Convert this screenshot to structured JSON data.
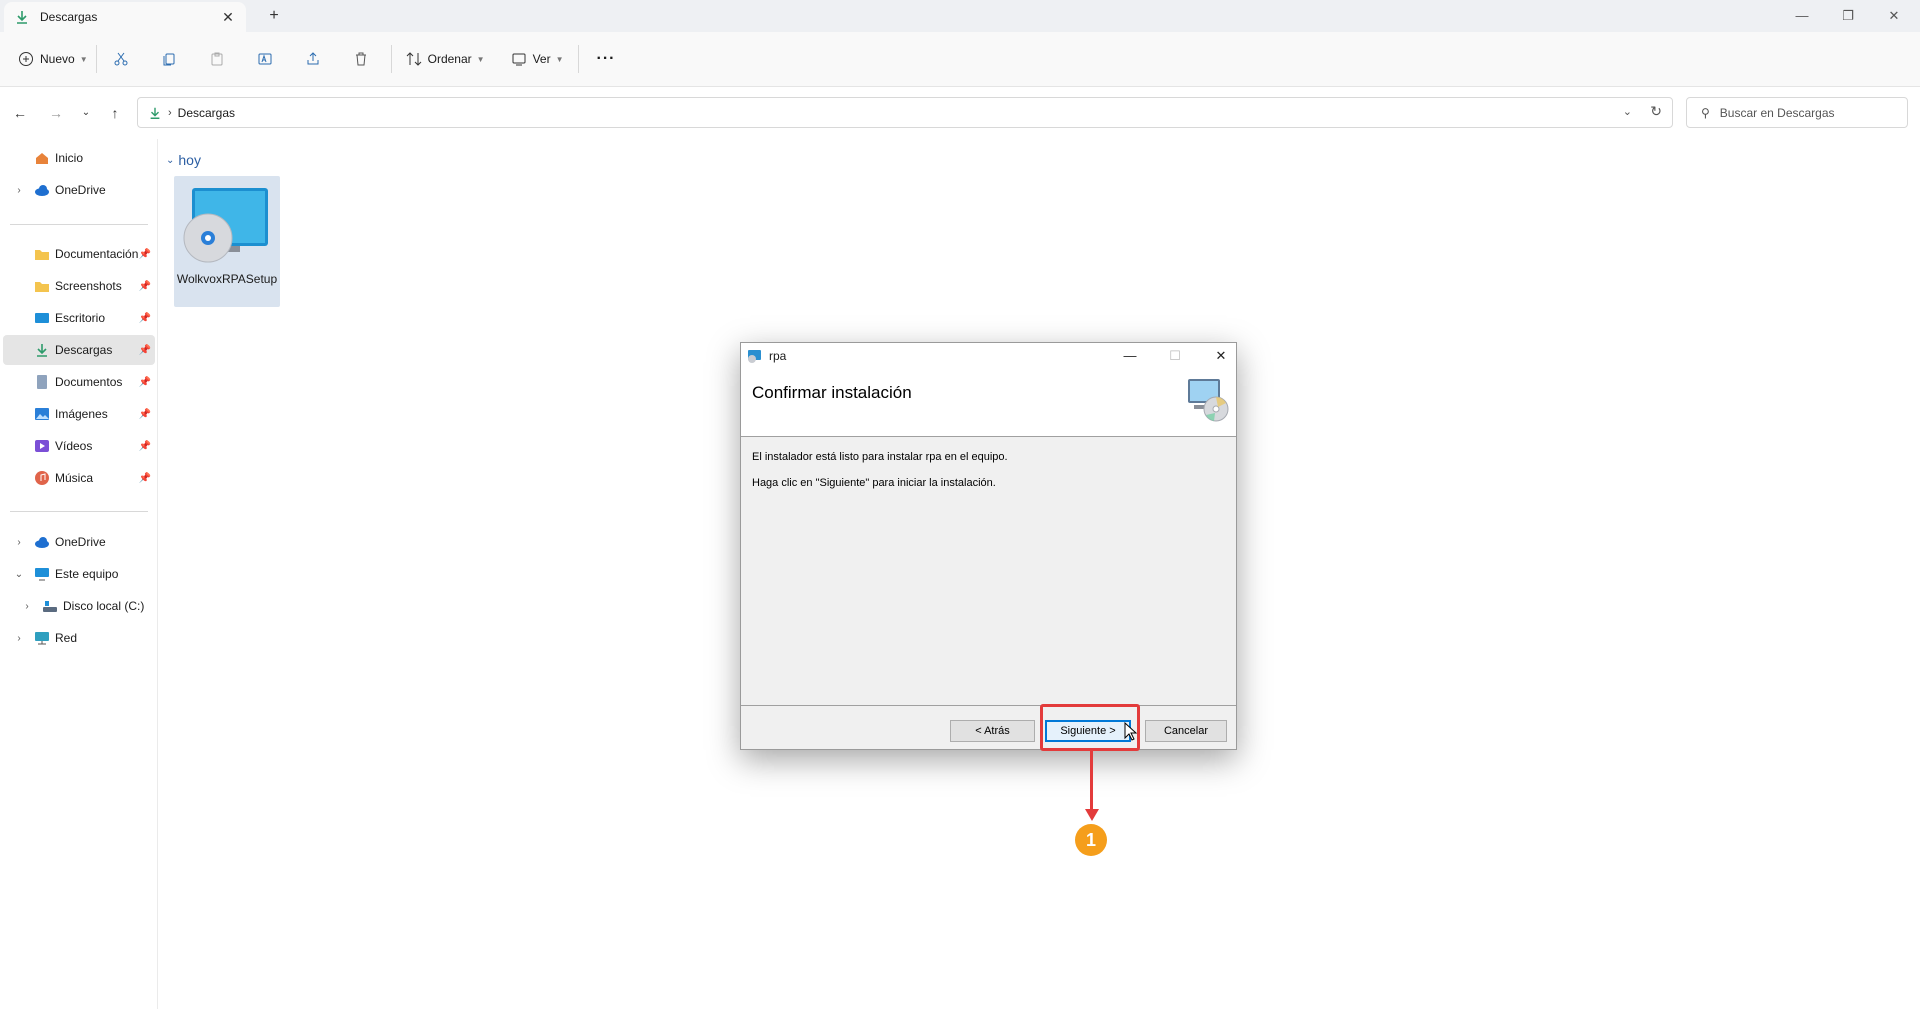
{
  "window": {
    "tab_label": "Descargas",
    "tab_close": "✕",
    "new_tab": "+"
  },
  "toolbar": {
    "new_label": "Nuevo",
    "sort_label": "Ordenar",
    "view_label": "Ver",
    "more_label": "···"
  },
  "address": {
    "current_folder": "Descargas",
    "search_placeholder": "Buscar en Descargas"
  },
  "sidebar": {
    "items": [
      {
        "label": "Inicio"
      },
      {
        "label": "OneDrive"
      },
      {
        "label": "Documentación"
      },
      {
        "label": "Screenshots"
      },
      {
        "label": "Escritorio"
      },
      {
        "label": "Descargas"
      },
      {
        "label": "Documentos"
      },
      {
        "label": "Imágenes"
      },
      {
        "label": "Vídeos"
      },
      {
        "label": "Música"
      },
      {
        "label": "OneDrive"
      },
      {
        "label": "Este equipo"
      },
      {
        "label": "Disco local (C:)"
      },
      {
        "label": "Red"
      }
    ]
  },
  "content": {
    "group_label": "hoy",
    "file_name": "WolkvoxRPASetup"
  },
  "dialog": {
    "title": "rpa",
    "heading": "Confirmar instalación",
    "line1": "El instalador está listo para instalar rpa en el equipo.",
    "line2": "Haga clic en \"Siguiente\" para iniciar la instalación.",
    "back_label": "< Atrás",
    "next_label": "Siguiente >",
    "cancel_label": "Cancelar"
  },
  "annotation": {
    "step_number": "1",
    "color": "#e33b3b",
    "badge_color": "#f59e1b"
  }
}
